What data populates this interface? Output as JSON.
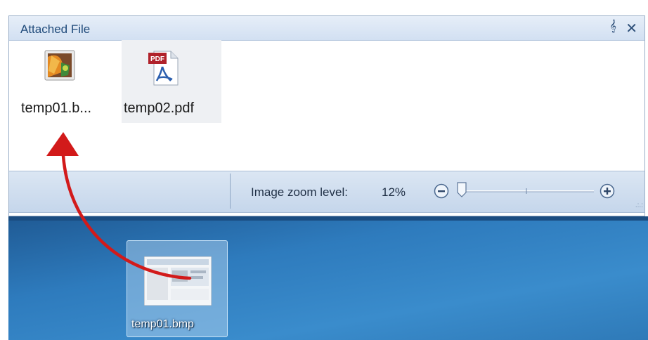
{
  "panel": {
    "title": "Attached File",
    "pin_icon": "pin-icon",
    "close_icon": "close-icon"
  },
  "files": [
    {
      "label": "temp01.b...",
      "icon": "bitmap-image-icon"
    },
    {
      "label": "temp02.pdf",
      "icon": "pdf-file-icon",
      "icon_badge": "PDF"
    }
  ],
  "statusbar": {
    "zoom_label": "Image zoom level:",
    "zoom_value": "12%",
    "zoom_level_fraction": 0.0,
    "zoom_out_icon": "zoom-out-icon",
    "zoom_in_icon": "zoom-in-icon"
  },
  "desktop": {
    "file_label": "temp01.bmp",
    "file_icon": "bitmap-thumbnail-icon"
  },
  "colors": {
    "title_text": "#1f4a7a",
    "arrow": "#d21a1a",
    "desktop_blue": "#2e7bbd",
    "statusbar": "#c5d6eb"
  }
}
